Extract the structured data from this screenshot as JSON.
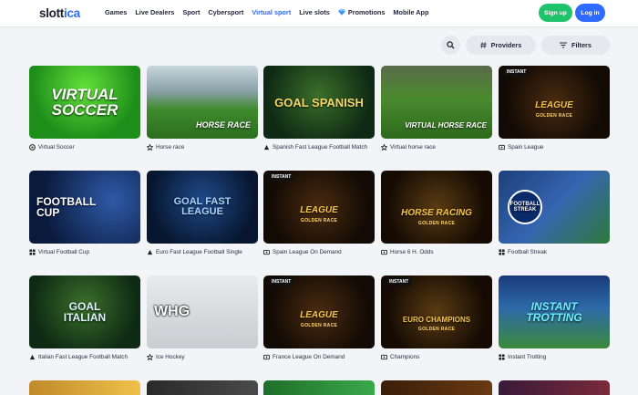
{
  "brand": {
    "name_prefix": "slott",
    "name_suffix": "ica"
  },
  "nav": {
    "items": [
      {
        "label": "Games"
      },
      {
        "label": "Live Dealers"
      },
      {
        "label": "Sport"
      },
      {
        "label": "Cybersport"
      },
      {
        "label": "Virtual sport",
        "active": true
      },
      {
        "label": "Live slots"
      },
      {
        "label": "Promotions"
      },
      {
        "label": "Mobile App"
      }
    ]
  },
  "auth": {
    "signup": "Sign up",
    "login": "Log in"
  },
  "toolbar": {
    "providers": "Providers",
    "filters": "Filters"
  },
  "colors": {
    "accent": "#2f6bff",
    "signup": "#1fc36b"
  },
  "games": [
    {
      "caption": "Virtual Soccer",
      "art": "VIRTUAL SOCCER",
      "icon": "chip-icon"
    },
    {
      "caption": "Horse race",
      "art": "HORSE RACE",
      "icon": "star-icon"
    },
    {
      "caption": "Spanish Fast League Football Match",
      "art": "GOAL SPANISH",
      "icon": "provider-icon"
    },
    {
      "caption": "Virtual horse race",
      "art": "VIRTUAL HORSE RACE",
      "icon": "star-icon"
    },
    {
      "caption": "Spain League",
      "art": "LEAGUE",
      "icon": "provider2-icon"
    },
    {
      "caption": "Virtual Football Cup",
      "art": "FOOTBALL CUP",
      "icon": "provider3-icon"
    },
    {
      "caption": "Euro Fast League Football Single",
      "art": "GOAL FAST LEAGUE",
      "icon": "provider-icon"
    },
    {
      "caption": "Spain League On Demand",
      "art": "LEAGUE",
      "icon": "provider2-icon"
    },
    {
      "caption": "Horse 6 H. Odds",
      "art": "HORSE RACING",
      "icon": "provider2-icon"
    },
    {
      "caption": "Football Streak",
      "art": "FOOTBALL STREAK",
      "icon": "provider3-icon"
    },
    {
      "caption": "Italian Fast League Football Match",
      "art": "GOAL ITALIAN",
      "icon": "provider-icon"
    },
    {
      "caption": "Ice Hockey",
      "art": "WHG",
      "icon": "star-icon"
    },
    {
      "caption": "France League On Demand",
      "art": "LEAGUE",
      "icon": "provider2-icon"
    },
    {
      "caption": "Champions",
      "art": "EURO CHAMPIONS",
      "icon": "provider2-icon"
    },
    {
      "caption": "Instant Trotting",
      "art": "INSTANT TROTTING",
      "icon": "provider3-icon"
    }
  ],
  "instant_label": "INSTANT",
  "golden_race": "GOLDEN RACE"
}
